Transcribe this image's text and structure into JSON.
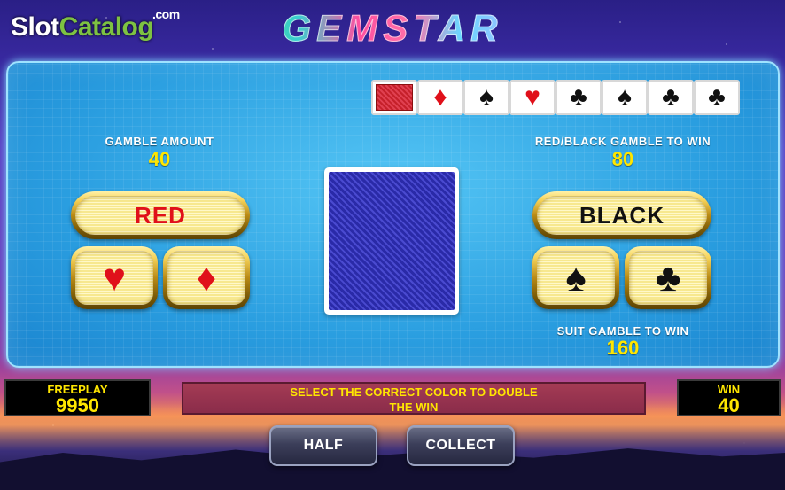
{
  "watermark": {
    "slot": "Slot",
    "catalog": "Catalog",
    "com": ".com"
  },
  "logo": {
    "text": "GEMSTAR"
  },
  "history": {
    "cards": [
      {
        "type": "back"
      },
      {
        "suit": "diamond",
        "glyph": "♦",
        "color": "red"
      },
      {
        "suit": "spade",
        "glyph": "♠",
        "color": "black"
      },
      {
        "suit": "heart",
        "glyph": "♥",
        "color": "red"
      },
      {
        "suit": "club",
        "glyph": "♣",
        "color": "black"
      },
      {
        "suit": "spade",
        "glyph": "♠",
        "color": "black"
      },
      {
        "suit": "club",
        "glyph": "♣",
        "color": "black"
      },
      {
        "suit": "club",
        "glyph": "♣",
        "color": "black"
      }
    ]
  },
  "gamble_amount": {
    "label": "GAMBLE AMOUNT",
    "value": "40"
  },
  "red_black": {
    "label": "RED/BLACK GAMBLE TO WIN",
    "value": "80"
  },
  "suit_gamble": {
    "label": "SUIT GAMBLE TO WIN",
    "value": "160"
  },
  "buttons": {
    "red": "RED",
    "black": "BLACK",
    "heart": "♥",
    "diamond": "♦",
    "spade": "♠",
    "club": "♣",
    "half": "HALF",
    "collect": "COLLECT"
  },
  "hud": {
    "freeplay_label": "FREEPLAY",
    "freeplay_value": "9950",
    "message_line1": "SELECT THE CORRECT COLOR TO DOUBLE",
    "message_line2": "THE WIN",
    "win_label": "WIN",
    "win_value": "40"
  },
  "colors": {
    "red_suit": "#e0101a",
    "hud_text": "#ffe600",
    "panel_blue": "#2a9ee0"
  }
}
